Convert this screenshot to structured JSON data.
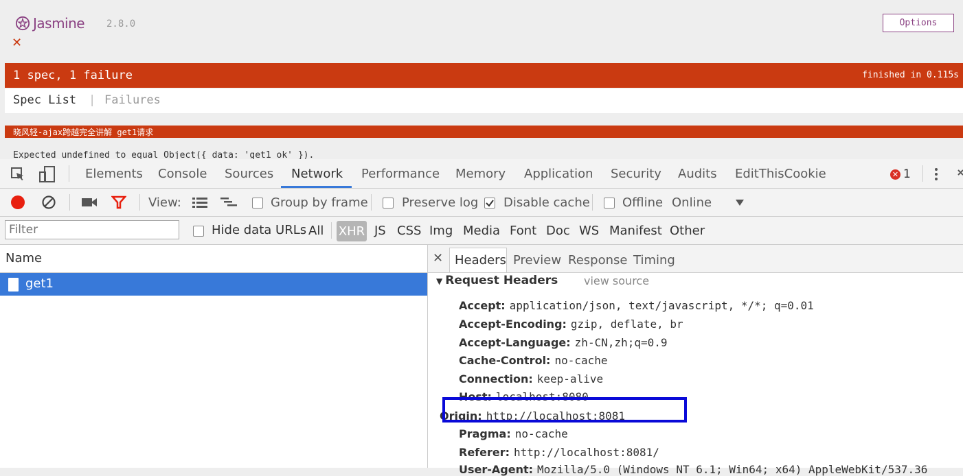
{
  "jasmine": {
    "logo_text": "Jasmine",
    "version": "2.8.0",
    "close_glyph": "✕",
    "options_label": "Options",
    "summary": "1 spec, 1 failure",
    "duration": "finished in 0.115s",
    "menu": {
      "spec_list": "Spec List",
      "separator": "|",
      "failures": "Failures"
    },
    "spec_name": "晓风轻-ajax跨越完全讲解 get1请求",
    "expected": "Expected undefined to equal Object({ data: 'get1 ok' })."
  },
  "devtools": {
    "tabs": [
      "Elements",
      "Console",
      "Sources",
      "Network",
      "Performance",
      "Memory",
      "Application",
      "Security",
      "Audits",
      "EditThisCookie"
    ],
    "active_tab": "Network",
    "error_count": "1",
    "toolbar": {
      "view_label": "View:",
      "group_by_frame": "Group by frame",
      "preserve_log": "Preserve log",
      "disable_cache": "Disable cache",
      "offline": "Offline",
      "online": "Online"
    },
    "filter": {
      "placeholder": "Filter",
      "hide_data_urls": "Hide data URLs",
      "types": [
        "All",
        "XHR",
        "JS",
        "CSS",
        "Img",
        "Media",
        "Font",
        "Doc",
        "WS",
        "Manifest",
        "Other"
      ],
      "active_type": "XHR"
    },
    "requests": {
      "column_name": "Name",
      "rows": [
        {
          "name": "get1"
        }
      ]
    },
    "detail": {
      "tabs": [
        "Headers",
        "Preview",
        "Response",
        "Timing"
      ],
      "section_title": "Request Headers",
      "view_source": "view source",
      "headers": [
        {
          "key": "Accept:",
          "value": "application/json, text/javascript, */*; q=0.01"
        },
        {
          "key": "Accept-Encoding:",
          "value": "gzip, deflate, br"
        },
        {
          "key": "Accept-Language:",
          "value": "zh-CN,zh;q=0.9"
        },
        {
          "key": "Cache-Control:",
          "value": "no-cache"
        },
        {
          "key": "Connection:",
          "value": "keep-alive"
        },
        {
          "key": "Host:",
          "value": "localhost:8080"
        },
        {
          "key": "Origin:",
          "value": "http://localhost:8081"
        },
        {
          "key": "Pragma:",
          "value": "no-cache"
        },
        {
          "key": "Referer:",
          "value": "http://localhost:8081/"
        },
        {
          "key": "User-Agent:",
          "value": "Mozilla/5.0 (Windows NT 6.1; Win64; x64) AppleWebKit/537.36"
        }
      ]
    }
  },
  "colors": {
    "jasmine_failure": "#ca3a11",
    "jasmine_brand": "#8a4182",
    "selection_blue": "#3879d9",
    "highlight_box": "#0a0ad8"
  }
}
